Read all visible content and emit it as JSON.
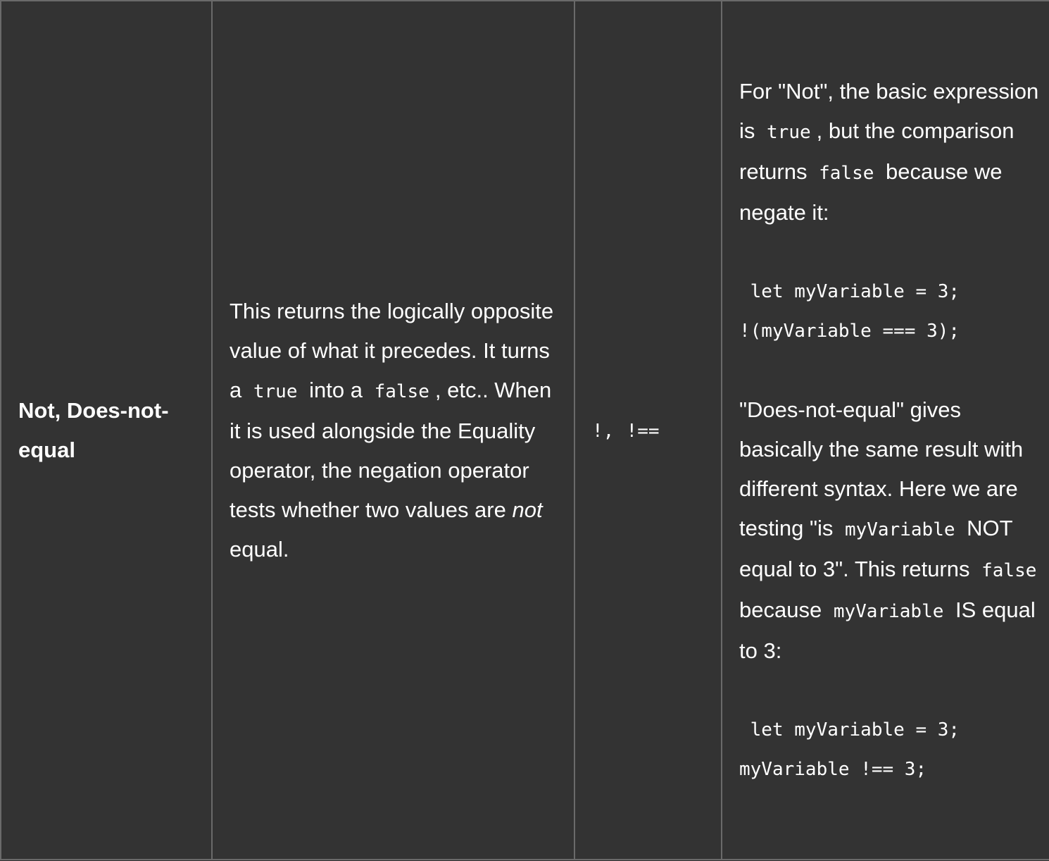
{
  "row": {
    "name": "Not, Does-not-equal",
    "description": {
      "part1": "This returns the logically opposite value of what it precedes. It turns a",
      "code1": "true",
      "part2": "into a",
      "code2": "false",
      "part3": ", etc.. When it is used alongside the Equality operator, the negation operator tests whether two values are",
      "emphasis": "not",
      "part4": "equal."
    },
    "symbols": {
      "sym1": "!",
      "sep": ",",
      "sym2": "!=="
    },
    "notes": {
      "intro1": "For \"Not\", the basic expression is",
      "code_true": "true",
      "intro2": ", but the comparison returns",
      "code_false": "false",
      "intro3": "because we negate it:",
      "code_a1": " let myVariable = 3;",
      "code_a2": "!(myVariable === 3);",
      "dne1": "\"Does-not-equal\" gives basically the same result with different syntax. Here we are testing \"is",
      "code_var": "myVariable",
      "dne2": "NOT equal to 3\". This returns",
      "code_false2": "false",
      "dne3": "because",
      "code_var2": "myVariable",
      "dne4": "IS equal to 3:",
      "code_b1": " let myVariable = 3;",
      "code_b2": "myVariable !== 3;"
    }
  }
}
